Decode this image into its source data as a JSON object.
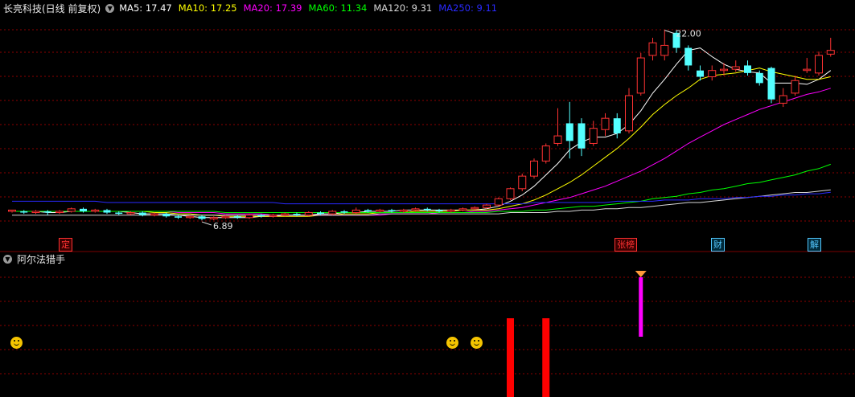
{
  "header": {
    "title": "长亮科技(日线 前复权)",
    "ma": [
      {
        "label": "MA5: 17.47",
        "color": "#ffffff"
      },
      {
        "label": "MA10: 17.25",
        "color": "#ffff00"
      },
      {
        "label": "MA20: 17.39",
        "color": "#ff00ff"
      },
      {
        "label": "MA60: 11.34",
        "color": "#00ff00"
      },
      {
        "label": "MA120: 9.31",
        "color": "#d8d8d8"
      },
      {
        "label": "MA250: 9.11",
        "color": "#2a2aff"
      }
    ]
  },
  "colors": {
    "up": "#ff3232",
    "down": "#54ffff",
    "grid": "#8b0000",
    "subbar": "#ff0000",
    "magenta": "#ff00ff"
  },
  "annotations": {
    "high": "22.00",
    "low": "6.89"
  },
  "tags": [
    {
      "label": "定",
      "color": "#ff3232"
    },
    {
      "label": "张榜",
      "color": "#ff3232"
    },
    {
      "label": "财",
      "color": "#54c8ff"
    },
    {
      "label": "解",
      "color": "#54c8ff"
    }
  ],
  "indicator": {
    "title": "阿尔法猎手",
    "icons": [
      "smile-icon",
      "smile-icon",
      "smile-icon",
      "diamond-icon"
    ]
  },
  "chart_data": {
    "type": "candlestick",
    "title": "长亮科技(日线 前复权)",
    "ylim": [
      6,
      23
    ],
    "series": [
      {
        "name": "MA5",
        "color": "#ffffff"
      },
      {
        "name": "MA10",
        "color": "#ffff00"
      },
      {
        "name": "MA20",
        "color": "#ff00ff"
      },
      {
        "name": "MA60",
        "color": "#00ff00"
      },
      {
        "name": "MA120",
        "color": "#d8d8d8"
      },
      {
        "name": "MA250",
        "color": "#2a2aff"
      }
    ],
    "candles": [
      [
        7.6,
        7.7,
        7.7,
        7.5
      ],
      [
        7.6,
        7.5,
        7.7,
        7.4
      ],
      [
        7.5,
        7.6,
        7.7,
        7.4
      ],
      [
        7.6,
        7.5,
        7.7,
        7.3
      ],
      [
        7.5,
        7.6,
        7.7,
        7.4
      ],
      [
        7.6,
        7.8,
        7.9,
        7.5
      ],
      [
        7.8,
        7.6,
        7.9,
        7.5
      ],
      [
        7.6,
        7.7,
        7.8,
        7.5
      ],
      [
        7.7,
        7.5,
        7.8,
        7.4
      ],
      [
        7.5,
        7.4,
        7.6,
        7.3
      ],
      [
        7.4,
        7.5,
        7.6,
        7.3
      ],
      [
        7.5,
        7.3,
        7.6,
        7.2
      ],
      [
        7.3,
        7.4,
        7.5,
        7.2
      ],
      [
        7.4,
        7.2,
        7.5,
        7.1
      ],
      [
        7.2,
        7.1,
        7.3,
        7.0
      ],
      [
        7.1,
        7.2,
        7.3,
        7.0
      ],
      [
        7.2,
        7.0,
        7.3,
        6.89
      ],
      [
        7.0,
        7.1,
        7.2,
        6.9
      ],
      [
        7.1,
        7.2,
        7.3,
        7.0
      ],
      [
        7.2,
        7.1,
        7.3,
        7.0
      ],
      [
        7.1,
        7.3,
        7.4,
        7.0
      ],
      [
        7.3,
        7.2,
        7.4,
        7.1
      ],
      [
        7.2,
        7.3,
        7.4,
        7.1
      ],
      [
        7.3,
        7.4,
        7.5,
        7.2
      ],
      [
        7.4,
        7.3,
        7.5,
        7.2
      ],
      [
        7.3,
        7.5,
        7.6,
        7.2
      ],
      [
        7.5,
        7.4,
        7.6,
        7.3
      ],
      [
        7.4,
        7.6,
        7.7,
        7.3
      ],
      [
        7.6,
        7.5,
        7.7,
        7.4
      ],
      [
        7.5,
        7.7,
        7.9,
        7.4
      ],
      [
        7.7,
        7.6,
        7.8,
        7.5
      ],
      [
        7.6,
        7.7,
        7.8,
        7.5
      ],
      [
        7.7,
        7.6,
        7.8,
        7.5
      ],
      [
        7.6,
        7.7,
        7.8,
        7.5
      ],
      [
        7.7,
        7.8,
        7.9,
        7.6
      ],
      [
        7.8,
        7.7,
        7.9,
        7.6
      ],
      [
        7.7,
        7.6,
        7.8,
        7.5
      ],
      [
        7.6,
        7.7,
        7.8,
        7.5
      ],
      [
        7.7,
        7.8,
        7.9,
        7.6
      ],
      [
        7.8,
        7.9,
        8.0,
        7.7
      ],
      [
        7.9,
        8.1,
        8.2,
        7.8
      ],
      [
        8.1,
        8.6,
        8.7,
        8.0
      ],
      [
        8.6,
        9.4,
        9.5,
        8.5
      ],
      [
        9.4,
        10.4,
        10.6,
        9.2
      ],
      [
        10.4,
        11.6,
        11.8,
        10.2
      ],
      [
        11.6,
        12.8,
        13.0,
        11.4
      ],
      [
        13.0,
        13.6,
        15.8,
        12.8
      ],
      [
        14.6,
        13.2,
        16.3,
        11.8
      ],
      [
        14.6,
        12.6,
        15.0,
        12.0
      ],
      [
        13.0,
        14.2,
        14.8,
        12.8
      ],
      [
        14.1,
        15.0,
        15.4,
        13.6
      ],
      [
        15.0,
        13.8,
        15.4,
        13.4
      ],
      [
        14.0,
        16.8,
        17.4,
        13.8
      ],
      [
        17.0,
        19.8,
        20.2,
        16.8
      ],
      [
        20.0,
        21.0,
        21.4,
        19.6
      ],
      [
        20.0,
        20.8,
        22.0,
        19.6
      ],
      [
        21.8,
        20.6,
        22.0,
        20.2
      ],
      [
        20.6,
        19.2,
        20.8,
        18.8
      ],
      [
        18.8,
        18.3,
        19.2,
        18.0
      ],
      [
        18.3,
        18.8,
        19.2,
        18.0
      ],
      [
        18.8,
        18.9,
        19.4,
        18.4
      ],
      [
        18.9,
        19.1,
        19.6,
        18.7
      ],
      [
        19.2,
        18.6,
        19.6,
        18.4
      ],
      [
        18.6,
        17.8,
        18.8,
        17.6
      ],
      [
        19.0,
        16.5,
        19.1,
        16.2
      ],
      [
        16.2,
        16.8,
        17.4,
        15.9
      ],
      [
        17.0,
        18.0,
        18.4,
        16.8
      ],
      [
        18.8,
        18.9,
        19.8,
        18.6
      ],
      [
        18.6,
        20.0,
        20.3,
        18.4
      ],
      [
        20.1,
        20.4,
        21.4,
        19.9
      ]
    ],
    "ma": {
      "MA5": [
        7.6,
        7.6,
        7.6,
        7.5,
        7.5,
        7.6,
        7.6,
        7.6,
        7.6,
        7.6,
        7.5,
        7.4,
        7.4,
        7.4,
        7.3,
        7.2,
        7.1,
        7.1,
        7.1,
        7.1,
        7.1,
        7.2,
        7.2,
        7.3,
        7.3,
        7.3,
        7.4,
        7.4,
        7.5,
        7.5,
        7.6,
        7.6,
        7.6,
        7.7,
        7.7,
        7.7,
        7.7,
        7.7,
        7.7,
        7.7,
        7.8,
        8.0,
        8.4,
        8.9,
        9.6,
        10.5,
        11.4,
        12.5,
        13.1,
        13.5,
        13.5,
        13.8,
        14.5,
        15.6,
        17.0,
        18.1,
        19.3,
        20.4,
        20.6,
        19.9,
        19.3,
        18.9,
        18.7,
        18.6,
        17.8,
        17.8,
        17.8,
        17.7,
        18.1,
        18.8
      ],
      "MA10": [
        7.6,
        7.6,
        7.6,
        7.6,
        7.6,
        7.6,
        7.6,
        7.6,
        7.6,
        7.6,
        7.6,
        7.6,
        7.5,
        7.5,
        7.4,
        7.4,
        7.3,
        7.3,
        7.2,
        7.2,
        7.2,
        7.2,
        7.2,
        7.2,
        7.2,
        7.2,
        7.3,
        7.3,
        7.4,
        7.4,
        7.4,
        7.5,
        7.5,
        7.5,
        7.6,
        7.6,
        7.6,
        7.6,
        7.7,
        7.7,
        7.7,
        7.8,
        8.0,
        8.2,
        8.5,
        8.9,
        9.4,
        9.9,
        10.5,
        11.2,
        11.9,
        12.6,
        13.4,
        14.3,
        15.3,
        16.1,
        16.8,
        17.4,
        18.1,
        18.4,
        18.5,
        18.6,
        18.8,
        19.0,
        18.7,
        18.5,
        18.3,
        18.1,
        18.1,
        18.3
      ],
      "MA20": [
        7.6,
        7.6,
        7.6,
        7.6,
        7.6,
        7.6,
        7.6,
        7.6,
        7.6,
        7.6,
        7.6,
        7.6,
        7.6,
        7.6,
        7.5,
        7.5,
        7.5,
        7.5,
        7.4,
        7.4,
        7.4,
        7.4,
        7.3,
        7.3,
        7.3,
        7.3,
        7.3,
        7.3,
        7.3,
        7.3,
        7.3,
        7.3,
        7.4,
        7.4,
        7.4,
        7.4,
        7.5,
        7.5,
        7.5,
        7.6,
        7.6,
        7.7,
        7.8,
        7.9,
        8.1,
        8.3,
        8.5,
        8.7,
        9.0,
        9.3,
        9.6,
        10.0,
        10.4,
        10.8,
        11.3,
        11.8,
        12.4,
        13.0,
        13.5,
        14.0,
        14.5,
        14.9,
        15.3,
        15.7,
        16.0,
        16.3,
        16.6,
        16.9,
        17.1,
        17.39
      ],
      "MA60": [
        7.6,
        7.6,
        7.6,
        7.6,
        7.6,
        7.6,
        7.6,
        7.6,
        7.6,
        7.6,
        7.6,
        7.6,
        7.6,
        7.6,
        7.6,
        7.6,
        7.6,
        7.6,
        7.5,
        7.5,
        7.5,
        7.5,
        7.5,
        7.5,
        7.5,
        7.5,
        7.5,
        7.5,
        7.5,
        7.5,
        7.5,
        7.5,
        7.5,
        7.5,
        7.5,
        7.5,
        7.5,
        7.5,
        7.5,
        7.5,
        7.5,
        7.6,
        7.6,
        7.6,
        7.7,
        7.7,
        7.8,
        7.9,
        8.0,
        8.0,
        8.1,
        8.2,
        8.3,
        8.4,
        8.6,
        8.7,
        8.8,
        9.0,
        9.1,
        9.3,
        9.4,
        9.6,
        9.8,
        9.9,
        10.1,
        10.3,
        10.5,
        10.8,
        11.0,
        11.34
      ],
      "MA120": [
        7.3,
        7.3,
        7.3,
        7.3,
        7.3,
        7.3,
        7.3,
        7.3,
        7.3,
        7.3,
        7.3,
        7.3,
        7.3,
        7.3,
        7.3,
        7.3,
        7.3,
        7.3,
        7.3,
        7.3,
        7.3,
        7.3,
        7.3,
        7.3,
        7.3,
        7.3,
        7.3,
        7.3,
        7.3,
        7.3,
        7.3,
        7.4,
        7.4,
        7.4,
        7.4,
        7.4,
        7.4,
        7.4,
        7.4,
        7.4,
        7.4,
        7.4,
        7.5,
        7.5,
        7.5,
        7.5,
        7.6,
        7.6,
        7.7,
        7.7,
        7.8,
        7.8,
        7.9,
        7.9,
        8.0,
        8.1,
        8.2,
        8.3,
        8.3,
        8.4,
        8.5,
        8.6,
        8.7,
        8.8,
        8.9,
        9.0,
        9.1,
        9.1,
        9.2,
        9.31
      ],
      "MA250": [
        8.4,
        8.4,
        8.4,
        8.4,
        8.4,
        8.4,
        8.4,
        8.4,
        8.3,
        8.3,
        8.3,
        8.3,
        8.3,
        8.3,
        8.3,
        8.3,
        8.3,
        8.3,
        8.3,
        8.3,
        8.3,
        8.3,
        8.3,
        8.2,
        8.2,
        8.2,
        8.2,
        8.2,
        8.2,
        8.2,
        8.2,
        8.2,
        8.2,
        8.2,
        8.2,
        8.2,
        8.2,
        8.2,
        8.2,
        8.2,
        8.2,
        8.2,
        8.2,
        8.2,
        8.3,
        8.3,
        8.3,
        8.3,
        8.3,
        8.3,
        8.3,
        8.4,
        8.4,
        8.4,
        8.4,
        8.5,
        8.5,
        8.5,
        8.6,
        8.6,
        8.6,
        8.7,
        8.7,
        8.8,
        8.8,
        8.9,
        8.9,
        9.0,
        9.0,
        9.11
      ]
    },
    "indicator_bars": [
      {
        "index": 42,
        "value": 1.0,
        "color": "#ff0000"
      },
      {
        "index": 45,
        "value": 1.0,
        "color": "#ff0000"
      },
      {
        "index": 53,
        "value": 0.8,
        "color": "#ff00ff"
      }
    ]
  }
}
